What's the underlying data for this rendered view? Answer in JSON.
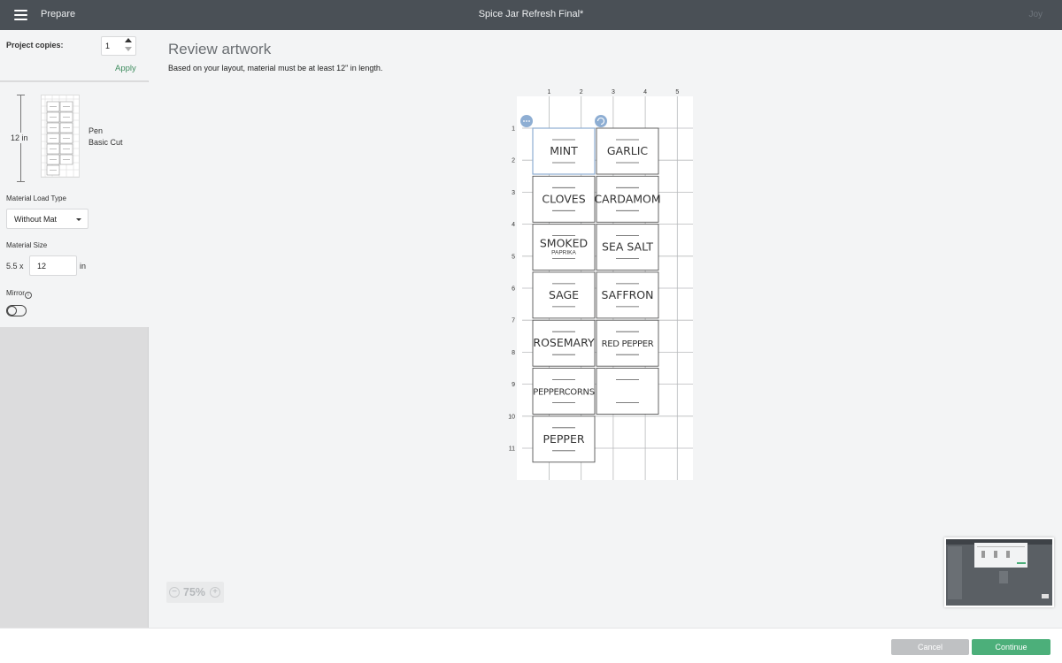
{
  "header": {
    "menu_icon": "hamburger-menu-icon",
    "prepare_label": "Prepare",
    "doc_title": "Spice Jar Refresh Final*",
    "user_name": "Joy"
  },
  "sidebar": {
    "copies_label": "Project copies:",
    "copies_value": "1",
    "apply_label": "Apply",
    "mat_length_label": "12 in",
    "pen_label": "Pen",
    "cut_label": "Basic Cut",
    "load_type_label": "Material Load Type",
    "load_type_value": "Without Mat",
    "material_size_label": "Material Size",
    "width_label": "5.5 x",
    "length_value": "12",
    "unit_label": "in",
    "mirror_label": "Mirror",
    "mirror_on": false
  },
  "main": {
    "title": "Review artwork",
    "subtitle": "Based on your layout, material must be at least 12\" in length."
  },
  "mat": {
    "col_ticks": [
      "1",
      "2",
      "3",
      "4",
      "5"
    ],
    "row_ticks": [
      "1",
      "2",
      "3",
      "4",
      "5",
      "6",
      "7",
      "8",
      "9",
      "10",
      "11"
    ],
    "labels": [
      {
        "text": "MINT",
        "sub": ""
      },
      {
        "text": "GARLIC",
        "sub": ""
      },
      {
        "text": "CLOVES",
        "sub": ""
      },
      {
        "text": "CARDAMOM",
        "sub": ""
      },
      {
        "text": "SMOKED",
        "sub": "PAPRIKA"
      },
      {
        "text": "SEA SALT",
        "sub": ""
      },
      {
        "text": "SAGE",
        "sub": ""
      },
      {
        "text": "SAFFRON",
        "sub": ""
      },
      {
        "text": "ROSEMARY",
        "sub": ""
      },
      {
        "text": "RED PEPPER",
        "sub": ""
      },
      {
        "text": "PEPPERCORNS",
        "sub": ""
      },
      {
        "text": "",
        "sub": ""
      },
      {
        "text": "PEPPER",
        "sub": ""
      }
    ],
    "selection_menu_icon": "more-options-icon",
    "rotate_icon": "rotate-icon"
  },
  "zoom": {
    "level": "75%",
    "minus": "−",
    "plus": "+"
  },
  "footer": {
    "cancel_label": "Cancel",
    "continue_label": "Continue"
  },
  "colors": {
    "topbar": "#4a5056",
    "accent_green": "#4caf7a",
    "apply_green": "#3f8d5f",
    "selection_blue": "#8eaed3"
  }
}
